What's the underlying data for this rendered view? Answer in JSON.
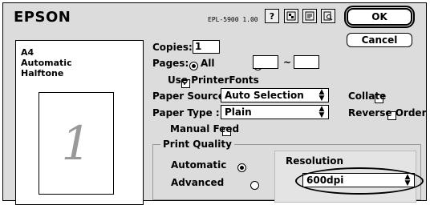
{
  "brand": "EPSON",
  "model": "EPL-5900   1.00",
  "toolbar": {
    "help_icon": "?",
    "icons": [
      "layout-icon",
      "watermark-icon",
      "preview-icon"
    ]
  },
  "buttons": {
    "ok": "OK",
    "cancel": "Cancel"
  },
  "preview": {
    "line1": "A4",
    "line2": "Automatic",
    "line3": "Halftone",
    "page_number": "1"
  },
  "copies": {
    "label": "Copies:",
    "value": "1"
  },
  "pages": {
    "label": "Pages:",
    "all_label": "All",
    "range_sep": "~",
    "from": "",
    "to": ""
  },
  "use_printer_fonts": {
    "label": "Use PrinterFonts",
    "checked": true
  },
  "paper_source": {
    "label": "Paper Source :",
    "value": "Auto Selection"
  },
  "collate": {
    "label": "Collate",
    "checked": false
  },
  "paper_type": {
    "label": "Paper Type :",
    "value": "Plain"
  },
  "reverse_order": {
    "label": "Reverse Order",
    "checked": false
  },
  "manual_feed": {
    "label": "Manual Feed",
    "checked": false
  },
  "print_quality": {
    "title": "Print Quality",
    "automatic": "Automatic",
    "advanced": "Advanced",
    "selected": "automatic"
  },
  "resolution": {
    "label": "Resolution",
    "value": "600dpi"
  }
}
